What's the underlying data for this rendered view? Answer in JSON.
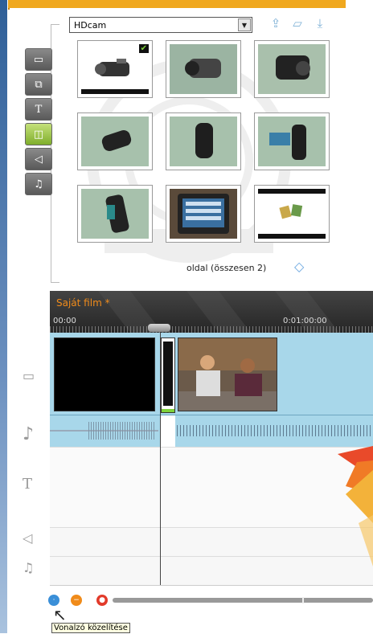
{
  "library": {
    "source_select": "HDcam",
    "page_info": "oldal (összesen 2)",
    "categories": [
      {
        "name": "video",
        "active": false
      },
      {
        "name": "transition",
        "active": false
      },
      {
        "name": "title",
        "active": false
      },
      {
        "name": "photo",
        "active": true
      },
      {
        "name": "sound-effect",
        "active": false
      },
      {
        "name": "music",
        "active": false
      }
    ],
    "thumbnails": [
      {
        "label": "camcorder-1",
        "selected": true
      },
      {
        "label": "camcorder-2",
        "selected": false
      },
      {
        "label": "camcorder-3",
        "selected": false
      },
      {
        "label": "camcorder-4",
        "selected": false
      },
      {
        "label": "camcorder-5",
        "selected": false
      },
      {
        "label": "camcorder-6",
        "selected": false
      },
      {
        "label": "camcorder-7",
        "selected": false
      },
      {
        "label": "camcorder-screen",
        "selected": false
      },
      {
        "label": "memory-cards",
        "selected": false
      }
    ]
  },
  "timeline": {
    "project_title": "Saját film *",
    "time_start": "00:00",
    "time_mid": "0:01:00:00"
  },
  "bottom": {
    "tooltip": "Vonalzó közelítése"
  },
  "colors": {
    "accent_orange": "#f0a81e",
    "track_blue": "#a8d7ea",
    "active_category": "#7fae2b"
  }
}
